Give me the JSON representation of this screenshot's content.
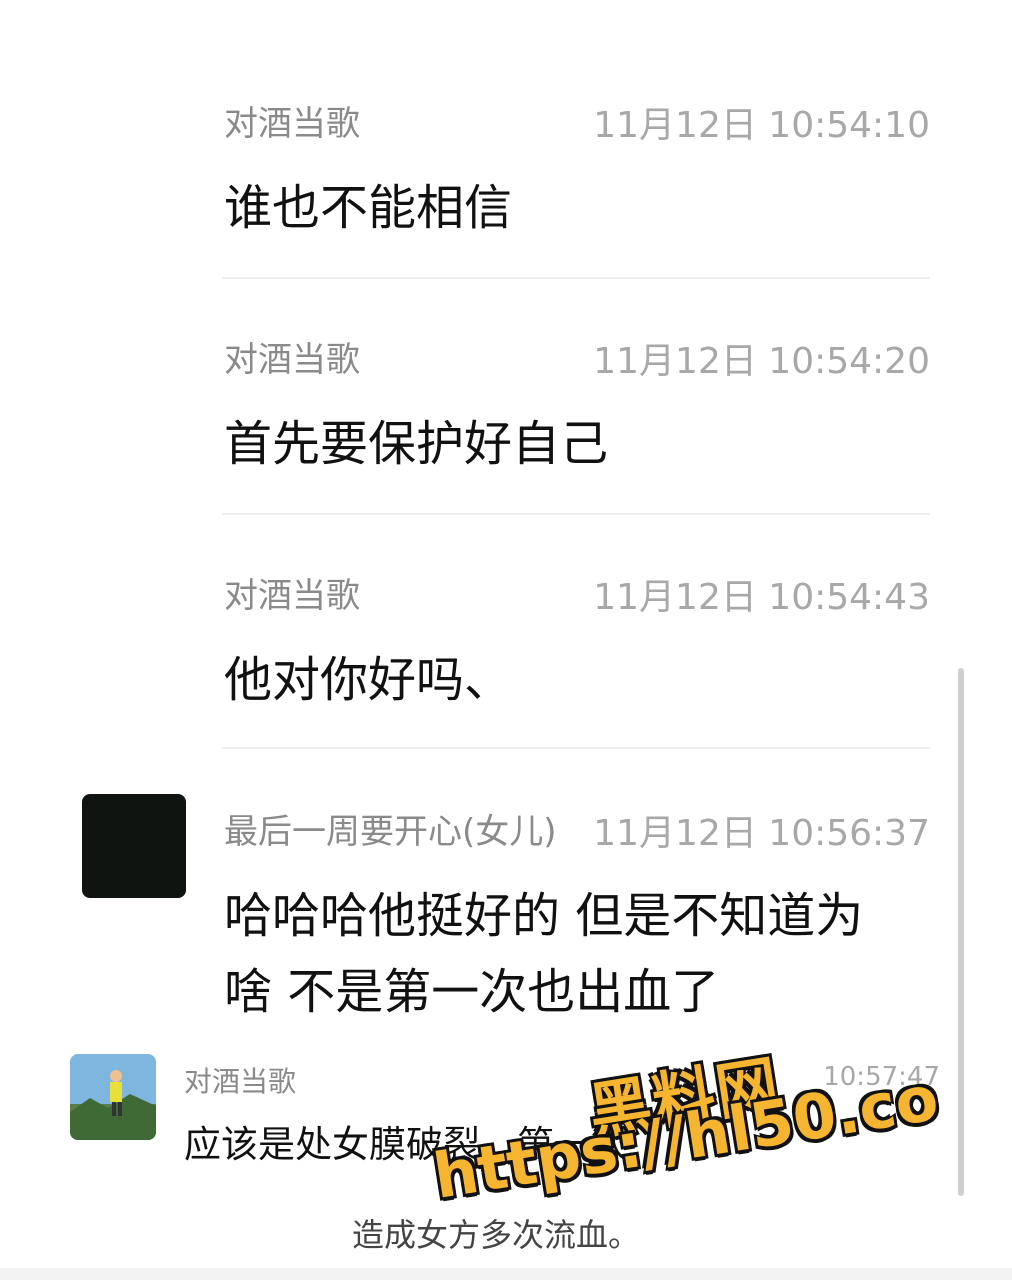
{
  "messages": [
    {
      "sender": "对酒当歌",
      "time": "11月12日 10:54:10",
      "text": "谁也不能相信"
    },
    {
      "sender": "对酒当歌",
      "time": "11月12日 10:54:20",
      "text": "首先要保护好自己"
    },
    {
      "sender": "对酒当歌",
      "time": "11月12日 10:54:43",
      "text": "他对你好吗、"
    },
    {
      "sender": "最后一周要开心(女儿)",
      "time": "11月12日 10:56:37",
      "text_line1": "哈哈哈他挺好的 但是不知道为",
      "text_line2": "啥 不是第一次也出血了"
    },
    {
      "sender": "对酒当歌",
      "time": "10:57:47",
      "text_line1": "应该是处女膜破裂，第一次",
      "text_line2": "造成女方多次流血。"
    }
  ],
  "watermark": {
    "title": "黑料网",
    "url": "https://hl50.co"
  }
}
